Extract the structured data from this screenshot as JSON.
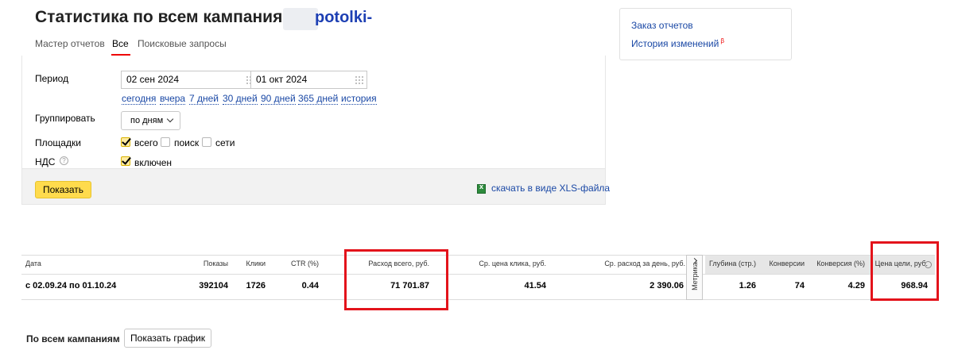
{
  "header": {
    "title": "Статистика по всем кампаниям",
    "domain": "potolki-"
  },
  "tabs": [
    {
      "label": "Мастер отчетов",
      "active": false
    },
    {
      "label": "Все",
      "active": true
    },
    {
      "label": "Поисковые запросы",
      "active": false
    }
  ],
  "form": {
    "period_label": "Период",
    "date_from": "02 сен 2024",
    "date_to": "01 окт 2024",
    "quick_ranges": [
      "сегодня",
      "вчера",
      "7 дней",
      "30 дней",
      "90 дней",
      "365 дней",
      "история"
    ],
    "group_label": "Группировать",
    "group_value": "по дням",
    "platforms_label": "Площадки",
    "platforms": [
      {
        "label": "всего",
        "checked": true
      },
      {
        "label": "поиск",
        "checked": false
      },
      {
        "label": "сети",
        "checked": false
      }
    ],
    "vat_label": "НДС",
    "vat_option": {
      "label": "включен",
      "checked": true
    },
    "show_button": "Показать",
    "xls_link": "скачать в виде XLS-файла"
  },
  "right_panel": {
    "order_reports": "Заказ отчетов",
    "change_history": "История изменений",
    "beta_mark": "β"
  },
  "stats_table": {
    "headers": {
      "date": "Дата",
      "impressions": "Показы",
      "clicks": "Клики",
      "ctr": "CTR (%)",
      "spend_total": "Расход всего, руб.",
      "avg_cpc": "Ср. цена клика, руб.",
      "avg_daily_spend": "Ср. расход за день, руб.",
      "metrika": "Метрика",
      "depth": "Глубина (стр.)",
      "conversions": "Конверсии",
      "conversion_rate": "Конверсия (%)",
      "goal_cost": "Цена цели, руб."
    },
    "row": {
      "date": "с 02.09.24 по 01.10.24",
      "impressions": "392104",
      "clicks": "1726",
      "ctr": "0.44",
      "spend_total": "71 701.87",
      "avg_cpc": "41.54",
      "avg_daily_spend": "2 390.06",
      "depth": "1.26",
      "conversions": "74",
      "conversion_rate": "4.29",
      "goal_cost": "968.94"
    }
  },
  "footer": {
    "campaigns_label": "По всем кампаниям",
    "graph_button": "Показать график"
  },
  "colors": {
    "accent_yellow": "#ffdb4d",
    "link_blue": "#1a48a5",
    "highlight_red": "#e3131b",
    "active_tab_red": "#e00000"
  }
}
